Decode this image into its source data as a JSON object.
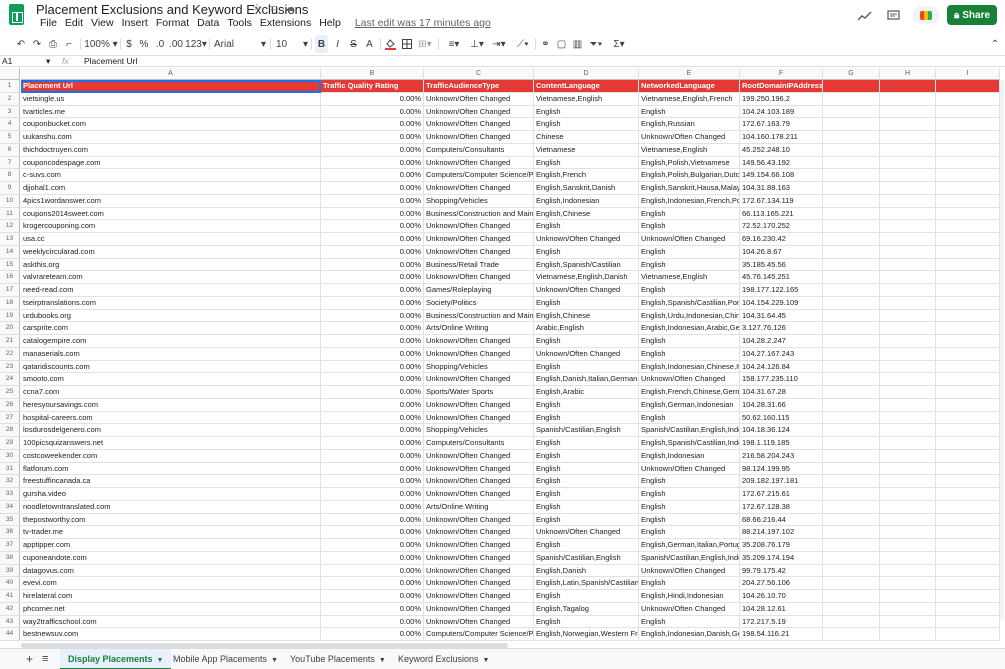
{
  "app": {
    "title": "Placement Exclusions and Keyword Exclusions",
    "menu": [
      "File",
      "Edit",
      "View",
      "Insert",
      "Format",
      "Data",
      "Tools",
      "Extensions",
      "Help"
    ],
    "last_edit": "Last edit was 17 minutes ago",
    "share_label": "Share"
  },
  "toolbar": {
    "zoom": "100%",
    "currency": "$",
    "percent": "%",
    "dec_decrease": ".0",
    "dec_increase": ".00",
    "format": "123",
    "font": "Arial",
    "font_size": "10",
    "bold": "B",
    "italic": "I",
    "strike": "S",
    "text_color": "A"
  },
  "formula": {
    "cell_ref": "A1",
    "fx": "fx",
    "value": "Placement Url"
  },
  "columns": [
    "A",
    "B",
    "C",
    "D",
    "E",
    "F",
    "G",
    "H",
    "I"
  ],
  "header_row": [
    "Placement Url",
    "Traffic Quality Rating",
    "TrafficAudienceType",
    "ContentLanguage",
    "NetworkedLanguage",
    "RootDomainIPAddress",
    "",
    "",
    ""
  ],
  "rows": [
    [
      "vietsingle.us",
      "0.00%",
      "Unknown/Often Changed",
      "Vietnamese,English",
      "Vietnamese,English,French",
      "199.250.196.2"
    ],
    [
      "tvarticles.me",
      "0.00%",
      "Unknown/Often Changed",
      "English",
      "English",
      "104.24.103.189"
    ],
    [
      "couponbucket.com",
      "0.00%",
      "Unknown/Often Changed",
      "English",
      "English,Russian",
      "172.67.163.79"
    ],
    [
      "uukanshu.com",
      "0.00%",
      "Unknown/Often Changed",
      "Chinese",
      "Unknown/Often Changed",
      "104.160.178.211"
    ],
    [
      "thichdoctruyen.com",
      "0.00%",
      "Computers/Consultants",
      "Vietnamese",
      "Vietnamese,English",
      "45.252.248.10"
    ],
    [
      "couponcodespage.com",
      "0.00%",
      "Unknown/Often Changed",
      "English",
      "English,Polish,Vietnamese",
      "149.56.43.192"
    ],
    [
      "c-suvs.com",
      "0.00%",
      "Computers/Computer Science/Pr",
      "English,French",
      "English,Polish,Bulgarian,Dutch",
      "149.154.66.108"
    ],
    [
      "djjohal1.com",
      "0.00%",
      "Unknown/Often Changed",
      "English,Sanskrit,Danish",
      "English,Sanskrit,Hausa,Malay,",
      "104.31.88.163"
    ],
    [
      "4pics1wordanswer.com",
      "0.00%",
      "Shopping/Vehicles",
      "English,Indonesian",
      "English,Indonesian,French,Po",
      "172.67.134.119"
    ],
    [
      "coupons2014sweet.com",
      "0.00%",
      "Business/Construction and Maint",
      "English,Chinese",
      "English",
      "66.113.165.221"
    ],
    [
      "krogercouponing.com",
      "0.00%",
      "Unknown/Often Changed",
      "English",
      "English",
      "72.52.170.252"
    ],
    [
      "usa.cc",
      "0.00%",
      "Unknown/Often Changed",
      "Unknown/Often Changed",
      "Unknown/Often Changed",
      "69.16.230.42"
    ],
    [
      "weeklycircularad.com",
      "0.00%",
      "Unknown/Often Changed",
      "English",
      "English",
      "104.26.8.67"
    ],
    [
      "askthis.org",
      "0.00%",
      "Business/Retail Trade",
      "English,Spanish/Castilian",
      "English",
      "35.185.45.56"
    ],
    [
      "valvrareteam.com",
      "0.00%",
      "Unknown/Often Changed",
      "Vietnamese,English,Danish",
      "Vietnamese,English",
      "45.76.145.251"
    ],
    [
      "need-read.com",
      "0.00%",
      "Games/Roleplaying",
      "Unknown/Often Changed",
      "English",
      "198.177.122.165"
    ],
    [
      "tseirptranslations.com",
      "0.00%",
      "Society/Politics",
      "English",
      "English,Spanish/Castilian,Port",
      "104.154.229.109"
    ],
    [
      "urdubooks.org",
      "0.00%",
      "Business/Construction and Maint",
      "English,Chinese",
      "English,Urdu,Indonesian,Chine",
      "104.31.64.45"
    ],
    [
      "carsprite.com",
      "0.00%",
      "Arts/Online Writing",
      "Arabic,English",
      "English,Indonesian,Arabic,Ger",
      "3.127.76.126"
    ],
    [
      "catalogempire.com",
      "0.00%",
      "Unknown/Often Changed",
      "English",
      "English",
      "104.28.2.247"
    ],
    [
      "manaserials.com",
      "0.00%",
      "Unknown/Often Changed",
      "Unknown/Often Changed",
      "English",
      "104.27.167.243"
    ],
    [
      "qataridiscounts.com",
      "0.00%",
      "Shopping/Vehicles",
      "English",
      "English,Indonesian,Chinese,Ita",
      "104.24.126.84"
    ],
    [
      "smooto.com",
      "0.00%",
      "Unknown/Often Changed",
      "English,Danish,Italian,German,",
      "Unknown/Often Changed",
      "158.177.235.110"
    ],
    [
      "ccna7.com",
      "0.00%",
      "Sports/Water Sports",
      "English,Arabic",
      "English,French,Chinese,Germ",
      "104.31.67.28"
    ],
    [
      "heresyoursavings.com",
      "0.00%",
      "Unknown/Often Changed",
      "English",
      "English,German,Indonesian",
      "104.28.31.66"
    ],
    [
      "hospital-careers.com",
      "0.00%",
      "Unknown/Often Changed",
      "English",
      "English",
      "50.62.160.115"
    ],
    [
      "losdurosdelgenero.com",
      "0.00%",
      "Shopping/Vehicles",
      "Spanish/Castilian,English",
      "Spanish/Castilian,English,Indo",
      "104.18.36.124"
    ],
    [
      "100picsquizanswers.net",
      "0.00%",
      "Computers/Consultants",
      "English",
      "English,Spanish/Castilian,Indo",
      "198.1.119.185"
    ],
    [
      "costcoweekender.com",
      "0.00%",
      "Unknown/Often Changed",
      "English",
      "English,Indonesian",
      "216.58.204.243"
    ],
    [
      "flatforum.com",
      "0.00%",
      "Unknown/Often Changed",
      "English",
      "Unknown/Often Changed",
      "98.124.199.95"
    ],
    [
      "freestuffincanada.ca",
      "0.00%",
      "Unknown/Often Changed",
      "English",
      "English",
      "209.182.197.181"
    ],
    [
      "gursha.video",
      "0.00%",
      "Unknown/Often Changed",
      "English",
      "English",
      "172.67.215.61"
    ],
    [
      "noodletowntranslated.com",
      "0.00%",
      "Arts/Online Writing",
      "English",
      "English",
      "172.67.128.38"
    ],
    [
      "thepostworthy.com",
      "0.00%",
      "Unknown/Often Changed",
      "English",
      "English",
      "68.66.216.44"
    ],
    [
      "tv-trader.me",
      "0.00%",
      "Unknown/Often Changed",
      "Unknown/Often Changed",
      "English",
      "88.214.197.102"
    ],
    [
      "apptipper.com",
      "0.00%",
      "Unknown/Often Changed",
      "English",
      "English,German,Italian,Portug",
      "35.208.76.179"
    ],
    [
      "cuponeandote.com",
      "0.00%",
      "Unknown/Often Changed",
      "Spanish/Castilian,English",
      "Spanish/Castilian,English,Indo",
      "35.209.174.194"
    ],
    [
      "datagovus.com",
      "0.00%",
      "Unknown/Often Changed",
      "English,Danish",
      "Unknown/Often Changed",
      "99.79.175.42"
    ],
    [
      "evevi.com",
      "0.00%",
      "Unknown/Often Changed",
      "English,Latin,Spanish/Castilian",
      "English",
      "204.27.56.106"
    ],
    [
      "hirelateral.com",
      "0.00%",
      "Unknown/Often Changed",
      "English",
      "English,Hindi,Indonesian",
      "104.26.10.70"
    ],
    [
      "phcorner.net",
      "0.00%",
      "Unknown/Often Changed",
      "English,Tagalog",
      "Unknown/Often Changed",
      "104.28.12.61"
    ],
    [
      "way2trafficschool.com",
      "0.00%",
      "Unknown/Often Changed",
      "English",
      "English",
      "172.217.5.19"
    ],
    [
      "bestnewsuv.com",
      "0.00%",
      "Computers/Computer Science/Pr",
      "English,Norwegian,Western Fri",
      "English,Indonesian,Danish,Ge",
      "198.54.116.21"
    ]
  ],
  "sheets": [
    {
      "label": "Display Placements",
      "active": true
    },
    {
      "label": "Mobile App Placements",
      "active": false
    },
    {
      "label": "YouTube Placements",
      "active": false
    },
    {
      "label": "Keyword Exclusions",
      "active": false
    }
  ]
}
